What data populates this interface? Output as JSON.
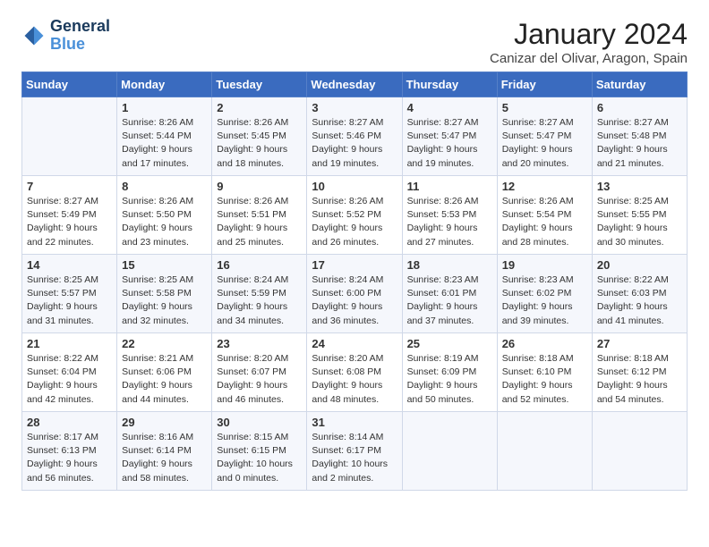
{
  "header": {
    "logo_line1": "General",
    "logo_line2": "Blue",
    "title": "January 2024",
    "subtitle": "Canizar del Olivar, Aragon, Spain"
  },
  "columns": [
    "Sunday",
    "Monday",
    "Tuesday",
    "Wednesday",
    "Thursday",
    "Friday",
    "Saturday"
  ],
  "weeks": [
    [
      {
        "day": "",
        "content": ""
      },
      {
        "day": "1",
        "content": "Sunrise: 8:26 AM\nSunset: 5:44 PM\nDaylight: 9 hours\nand 17 minutes."
      },
      {
        "day": "2",
        "content": "Sunrise: 8:26 AM\nSunset: 5:45 PM\nDaylight: 9 hours\nand 18 minutes."
      },
      {
        "day": "3",
        "content": "Sunrise: 8:27 AM\nSunset: 5:46 PM\nDaylight: 9 hours\nand 19 minutes."
      },
      {
        "day": "4",
        "content": "Sunrise: 8:27 AM\nSunset: 5:47 PM\nDaylight: 9 hours\nand 19 minutes."
      },
      {
        "day": "5",
        "content": "Sunrise: 8:27 AM\nSunset: 5:47 PM\nDaylight: 9 hours\nand 20 minutes."
      },
      {
        "day": "6",
        "content": "Sunrise: 8:27 AM\nSunset: 5:48 PM\nDaylight: 9 hours\nand 21 minutes."
      }
    ],
    [
      {
        "day": "7",
        "content": "Sunrise: 8:27 AM\nSunset: 5:49 PM\nDaylight: 9 hours\nand 22 minutes."
      },
      {
        "day": "8",
        "content": "Sunrise: 8:26 AM\nSunset: 5:50 PM\nDaylight: 9 hours\nand 23 minutes."
      },
      {
        "day": "9",
        "content": "Sunrise: 8:26 AM\nSunset: 5:51 PM\nDaylight: 9 hours\nand 25 minutes."
      },
      {
        "day": "10",
        "content": "Sunrise: 8:26 AM\nSunset: 5:52 PM\nDaylight: 9 hours\nand 26 minutes."
      },
      {
        "day": "11",
        "content": "Sunrise: 8:26 AM\nSunset: 5:53 PM\nDaylight: 9 hours\nand 27 minutes."
      },
      {
        "day": "12",
        "content": "Sunrise: 8:26 AM\nSunset: 5:54 PM\nDaylight: 9 hours\nand 28 minutes."
      },
      {
        "day": "13",
        "content": "Sunrise: 8:25 AM\nSunset: 5:55 PM\nDaylight: 9 hours\nand 30 minutes."
      }
    ],
    [
      {
        "day": "14",
        "content": "Sunrise: 8:25 AM\nSunset: 5:57 PM\nDaylight: 9 hours\nand 31 minutes."
      },
      {
        "day": "15",
        "content": "Sunrise: 8:25 AM\nSunset: 5:58 PM\nDaylight: 9 hours\nand 32 minutes."
      },
      {
        "day": "16",
        "content": "Sunrise: 8:24 AM\nSunset: 5:59 PM\nDaylight: 9 hours\nand 34 minutes."
      },
      {
        "day": "17",
        "content": "Sunrise: 8:24 AM\nSunset: 6:00 PM\nDaylight: 9 hours\nand 36 minutes."
      },
      {
        "day": "18",
        "content": "Sunrise: 8:23 AM\nSunset: 6:01 PM\nDaylight: 9 hours\nand 37 minutes."
      },
      {
        "day": "19",
        "content": "Sunrise: 8:23 AM\nSunset: 6:02 PM\nDaylight: 9 hours\nand 39 minutes."
      },
      {
        "day": "20",
        "content": "Sunrise: 8:22 AM\nSunset: 6:03 PM\nDaylight: 9 hours\nand 41 minutes."
      }
    ],
    [
      {
        "day": "21",
        "content": "Sunrise: 8:22 AM\nSunset: 6:04 PM\nDaylight: 9 hours\nand 42 minutes."
      },
      {
        "day": "22",
        "content": "Sunrise: 8:21 AM\nSunset: 6:06 PM\nDaylight: 9 hours\nand 44 minutes."
      },
      {
        "day": "23",
        "content": "Sunrise: 8:20 AM\nSunset: 6:07 PM\nDaylight: 9 hours\nand 46 minutes."
      },
      {
        "day": "24",
        "content": "Sunrise: 8:20 AM\nSunset: 6:08 PM\nDaylight: 9 hours\nand 48 minutes."
      },
      {
        "day": "25",
        "content": "Sunrise: 8:19 AM\nSunset: 6:09 PM\nDaylight: 9 hours\nand 50 minutes."
      },
      {
        "day": "26",
        "content": "Sunrise: 8:18 AM\nSunset: 6:10 PM\nDaylight: 9 hours\nand 52 minutes."
      },
      {
        "day": "27",
        "content": "Sunrise: 8:18 AM\nSunset: 6:12 PM\nDaylight: 9 hours\nand 54 minutes."
      }
    ],
    [
      {
        "day": "28",
        "content": "Sunrise: 8:17 AM\nSunset: 6:13 PM\nDaylight: 9 hours\nand 56 minutes."
      },
      {
        "day": "29",
        "content": "Sunrise: 8:16 AM\nSunset: 6:14 PM\nDaylight: 9 hours\nand 58 minutes."
      },
      {
        "day": "30",
        "content": "Sunrise: 8:15 AM\nSunset: 6:15 PM\nDaylight: 10 hours\nand 0 minutes."
      },
      {
        "day": "31",
        "content": "Sunrise: 8:14 AM\nSunset: 6:17 PM\nDaylight: 10 hours\nand 2 minutes."
      },
      {
        "day": "",
        "content": ""
      },
      {
        "day": "",
        "content": ""
      },
      {
        "day": "",
        "content": ""
      }
    ]
  ]
}
